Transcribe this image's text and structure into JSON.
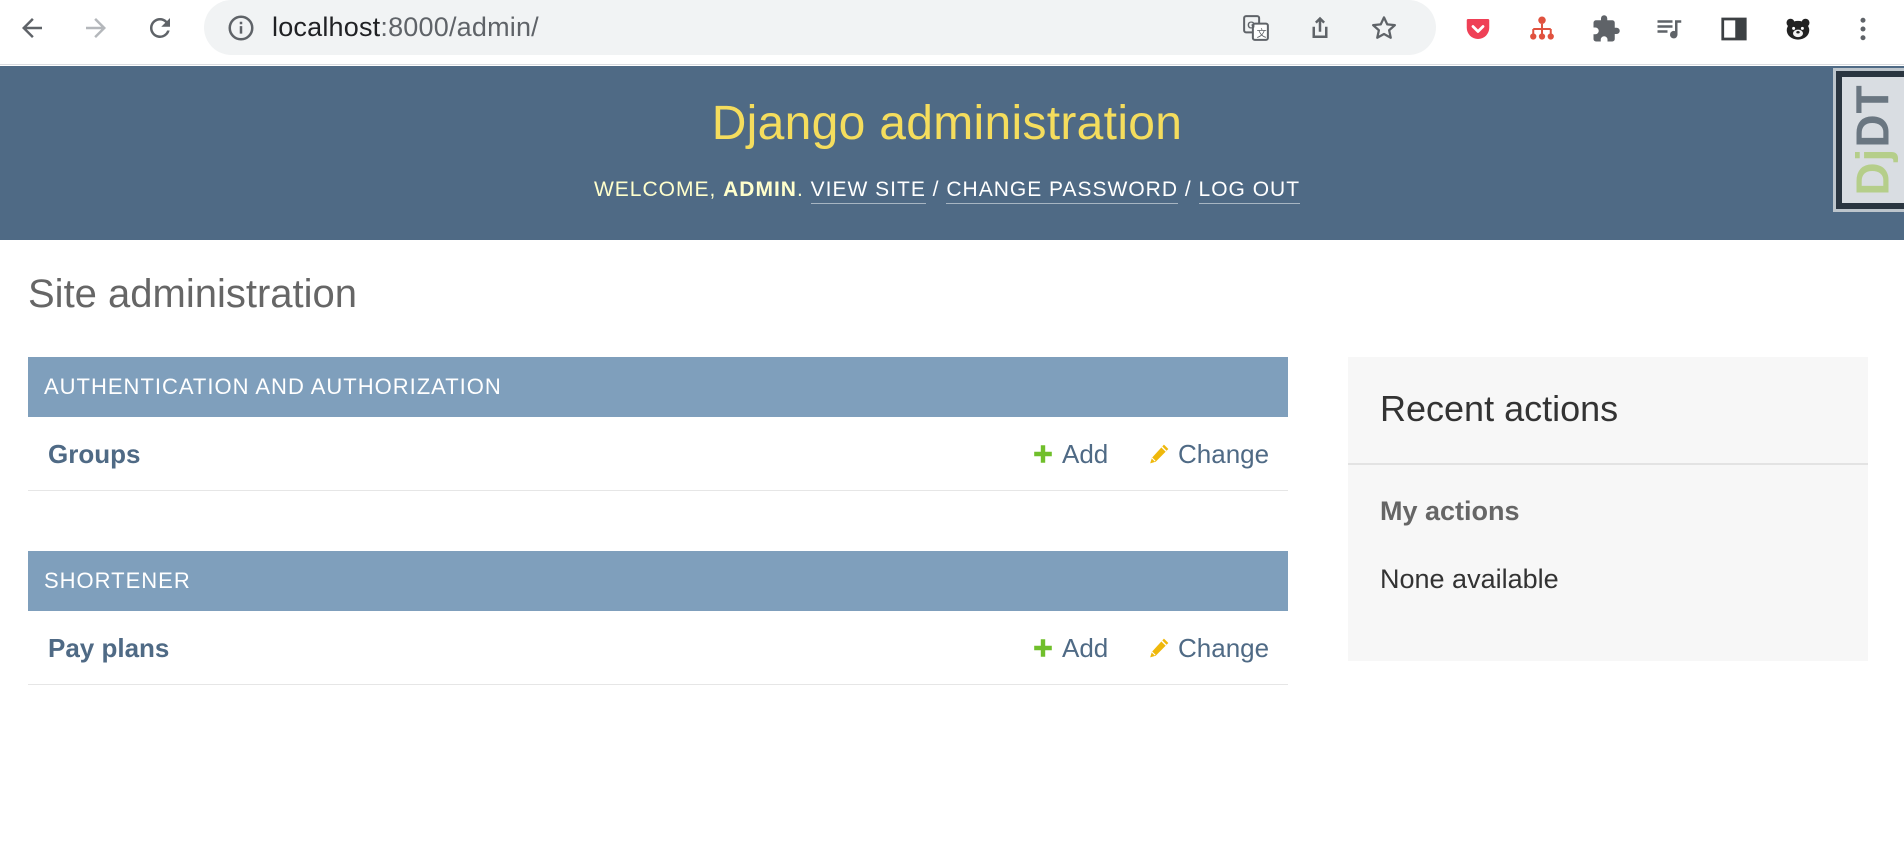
{
  "browser": {
    "url_host": "localhost",
    "url_path": ":8000/admin/"
  },
  "header": {
    "site_name": "Django administration",
    "welcome": "Welcome,",
    "username": "admin",
    "view_site": "View site",
    "change_password": "Change password",
    "log_out": "Log out",
    "separator": "/"
  },
  "debug_toolbar": {
    "label_dj": "Dj",
    "label_dt": "DT"
  },
  "content": {
    "title": "Site administration",
    "apps": [
      {
        "name": "Authentication and Authorization",
        "models": [
          {
            "name": "Groups",
            "add": "Add",
            "change": "Change"
          }
        ]
      },
      {
        "name": "Shortener",
        "models": [
          {
            "name": "Pay plans",
            "add": "Add",
            "change": "Change"
          }
        ]
      }
    ]
  },
  "recent_actions": {
    "title": "Recent actions",
    "subtitle": "My actions",
    "empty": "None available"
  },
  "colors": {
    "header_bg": "#4f6a85",
    "site_name": "#f5dd5d",
    "caption_bg": "#7f9fbc",
    "link": "#4f6a85",
    "add_icon": "#70bf2b",
    "change_icon": "#efb80b"
  },
  "icons": {
    "back": "arrow-left-icon",
    "forward": "arrow-right-icon",
    "reload": "reload-icon",
    "info": "info-icon",
    "translate": "translate-icon",
    "share": "share-icon",
    "bookmark": "star-icon",
    "pocket": "pocket-icon",
    "sitemap": "sitemap-icon",
    "extensions": "puzzle-icon",
    "media": "music-queue-icon",
    "side_panel": "side-panel-icon",
    "profile": "bear-avatar-icon",
    "menu": "more-vertical-icon",
    "add": "plus-icon",
    "change": "pencil-icon"
  }
}
